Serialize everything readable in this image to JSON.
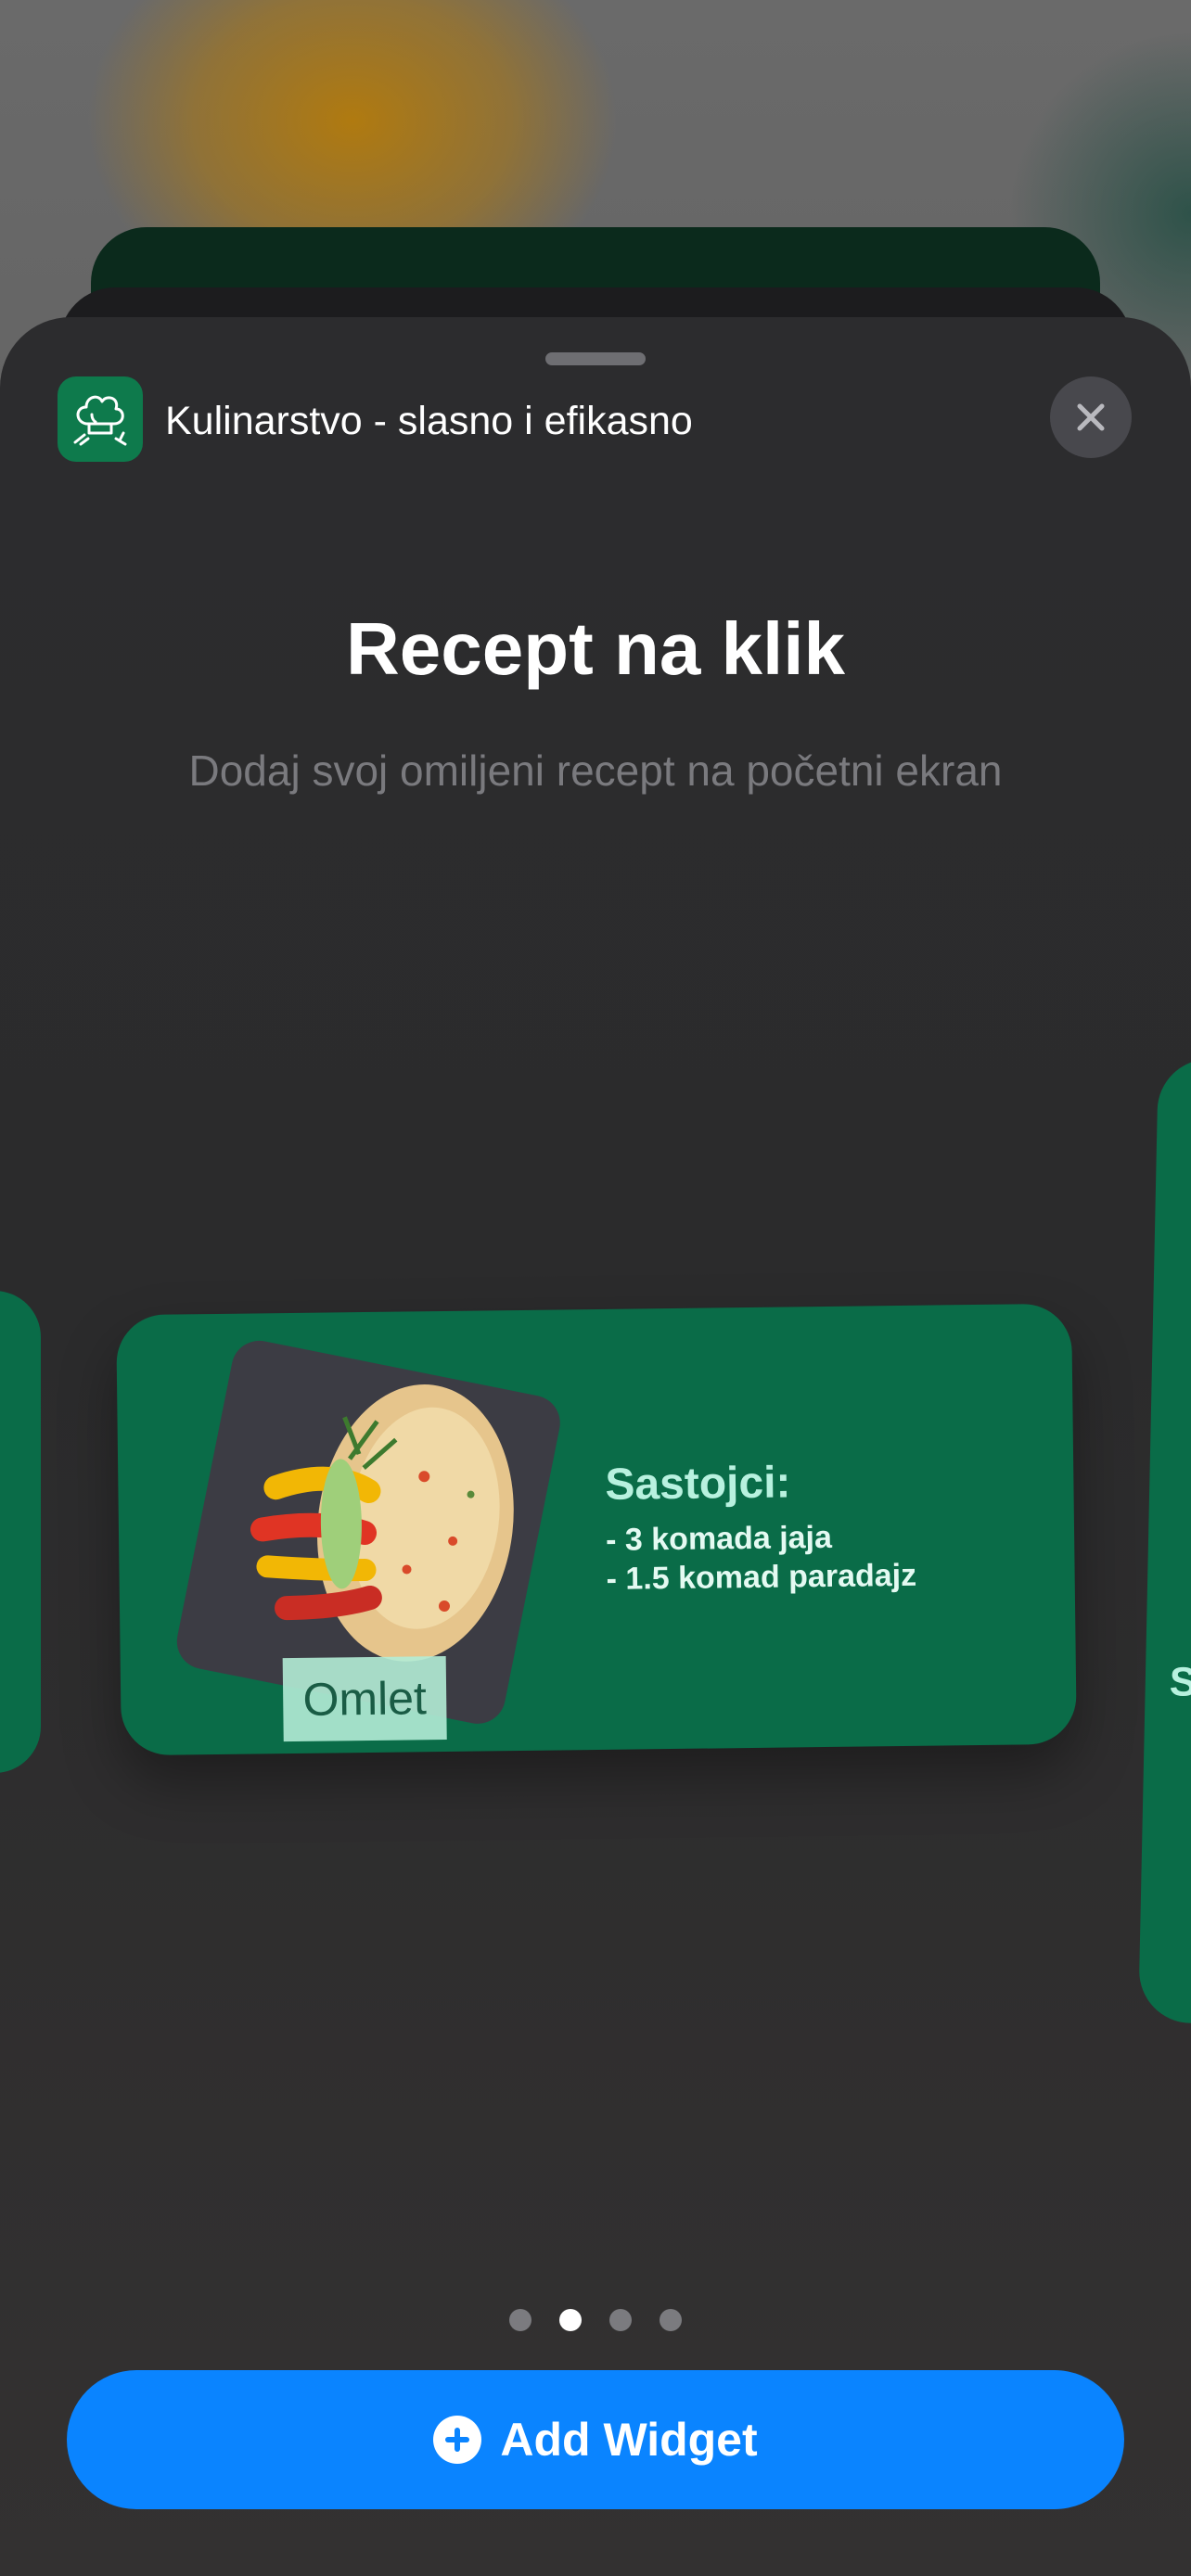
{
  "app": {
    "name": "Kulinarstvo - slasno i efikasno",
    "icon": "chef-hat-icon"
  },
  "sheet": {
    "title": "Recept na klik",
    "subtitle": "Dodaj svoj omiljeni recept na početni ekran"
  },
  "widget": {
    "recipe_name": "Omlet",
    "ingredients_title": "Sastojci:",
    "ingredients": [
      "- 3 komada jaja",
      "- 1.5 komad paradajz"
    ],
    "background_color": "#0a6c48"
  },
  "peek_right": {
    "letter": "S"
  },
  "pager": {
    "count": 4,
    "current": 2
  },
  "add_button": {
    "label": "Add Widget",
    "icon": "plus-circle-icon",
    "color": "#0a84ff"
  }
}
